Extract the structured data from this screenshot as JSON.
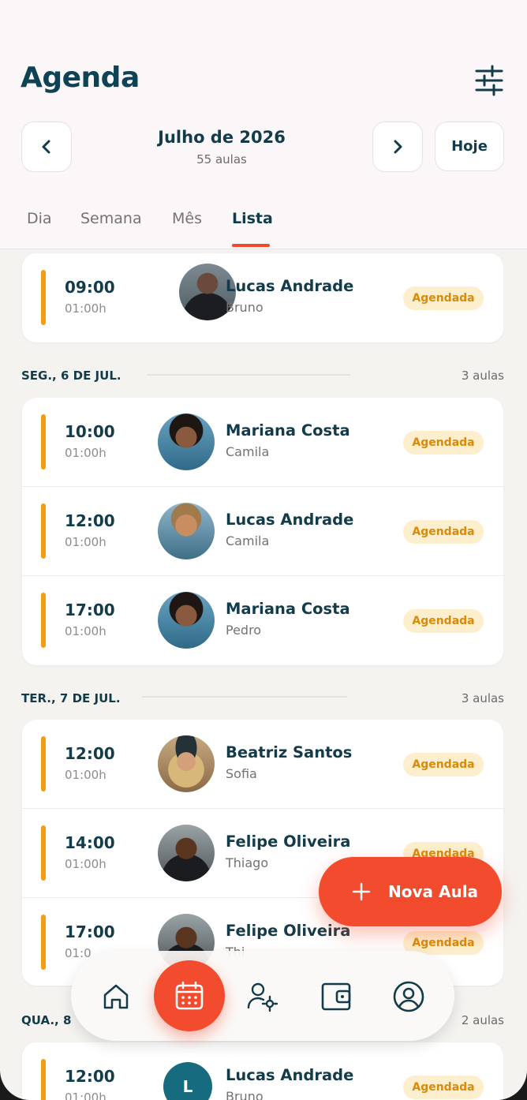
{
  "header": {
    "title": "Agenda",
    "month": "Julho de 2026",
    "lessons_count": "55 aulas",
    "today_label": "Hoje"
  },
  "tabs": [
    {
      "label": "Dia"
    },
    {
      "label": "Semana"
    },
    {
      "label": "Mês"
    },
    {
      "label": "Lista",
      "active": true
    }
  ],
  "sections": [
    {
      "items": [
        {
          "time": "09:00",
          "duration": "01:00h",
          "name": "Lucas Andrade",
          "instructor": "Bruno",
          "status": "Agendada"
        }
      ]
    },
    {
      "label": "SEG., 6 DE JUL.",
      "count": "3 aulas",
      "items": [
        {
          "time": "10:00",
          "duration": "01:00h",
          "name": "Mariana Costa",
          "instructor": "Camila",
          "status": "Agendada"
        },
        {
          "time": "12:00",
          "duration": "01:00h",
          "name": "Lucas Andrade",
          "instructor": "Camila",
          "status": "Agendada"
        },
        {
          "time": "17:00",
          "duration": "01:00h",
          "name": "Mariana Costa",
          "instructor": "Pedro",
          "status": "Agendada"
        }
      ]
    },
    {
      "label": "TER., 7 DE JUL.",
      "count": "3 aulas",
      "items": [
        {
          "time": "12:00",
          "duration": "01:00h",
          "name": "Beatriz Santos",
          "instructor": "Sofia",
          "status": "Agendada"
        },
        {
          "time": "14:00",
          "duration": "01:00h",
          "name": "Felipe Oliveira",
          "instructor": "Thiago",
          "status": "Agendada"
        },
        {
          "time": "17:00",
          "duration": "01:0",
          "name": "Felipe Oliveira",
          "instructor": "Thi",
          "status": "Agendada"
        }
      ]
    },
    {
      "label": "QUA., 8",
      "count": "2 aulas",
      "items": [
        {
          "time": "12:00",
          "duration": "01:00h",
          "name": "Lucas Andrade",
          "instructor": "Bruno",
          "status": "Agendada",
          "avatar_letter": "L"
        }
      ]
    }
  ],
  "fab": {
    "label": "Nova Aula"
  },
  "bottom_nav": [
    {
      "icon": "home-icon"
    },
    {
      "icon": "calendar-icon",
      "active": true
    },
    {
      "icon": "instructor-settings-icon"
    },
    {
      "icon": "wallet-icon"
    },
    {
      "icon": "profile-icon"
    }
  ],
  "colors": {
    "accent": "#f24b2e",
    "primary_text": "#133b4a",
    "status_bar": "#f29e12",
    "badge_bg": "#fdefcd",
    "badge_text": "#d98a0a"
  }
}
